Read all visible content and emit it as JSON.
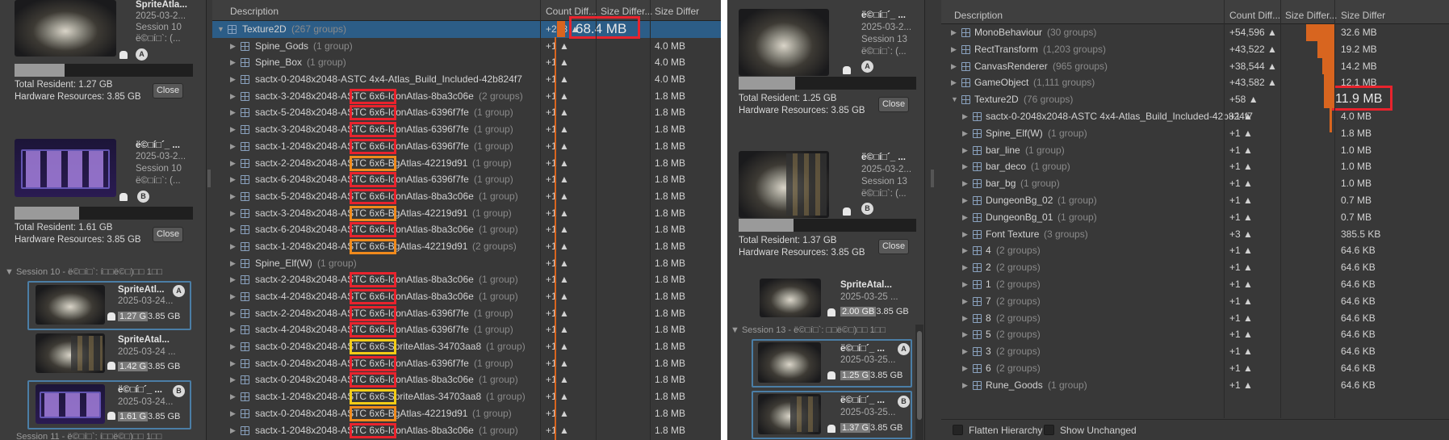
{
  "left": {
    "sessions": [
      {
        "name": "SpriteAtla...",
        "date": "2025-03-2...",
        "session": "Session 10",
        "meta": "ë©□í□`: (...",
        "badge": "A",
        "total": "Total Resident: 1.27 GB",
        "hw": "Hardware Resources: 3.85 GB",
        "close": "Close"
      },
      {
        "name": "ë©□í□´_ ...",
        "date": "2025-03-2...",
        "session": "Session 10",
        "meta": "ë©□í□`: (...",
        "badge": "B",
        "total": "Total Resident: 1.61 GB",
        "hw": "Hardware Resources: 3.85 GB",
        "close": "Close"
      }
    ],
    "group_header": "Session 10 - ë©□í□`: í□□ë©□)□□ 1□□",
    "group_items": [
      {
        "name": "SpriteAtl...",
        "date": "2025-03-24...",
        "a": "1.27 G",
        "b": "3.85 GB",
        "badge": "A"
      },
      {
        "name": "SpriteAtal...",
        "date": "2025-03-24 ...",
        "a": "1.42 G",
        "b": "3.85 GB",
        "badge": ""
      },
      {
        "name": "ë©□í□´_ ...",
        "date": "2025-03-24...",
        "a": "1.61 G",
        "b": "3.85 GB",
        "badge": "B"
      }
    ],
    "next_group": "Session 11 - ë©□í□`: í□□ë©□)□□ 1□□",
    "columns": {
      "desc": "Description",
      "count": "Count Diff...",
      "size": "Size Differ...",
      "size2": "Size Differ"
    },
    "rows": [
      {
        "t": "▼",
        "name": "Texture2D",
        "grp": "(267 groups)",
        "cnt": "+278 ▲",
        "sz": "68.4 MB",
        "sel": true
      },
      {
        "t": "▶",
        "name": "Spine_Gods",
        "grp": "(1 group)",
        "cnt": "+1 ▲",
        "sz": "4.0 MB"
      },
      {
        "t": "▶",
        "name": "Spine_Box",
        "grp": "(1 group)",
        "cnt": "+1 ▲",
        "sz": "4.0 MB"
      },
      {
        "t": "▶",
        "name": "sactx-0-2048x2048-ASTC 4x4-Atlas_Build_Included-42b824f7",
        "grp": "",
        "cnt": "+1 ▲",
        "sz": "4.0 MB"
      },
      {
        "t": "▶",
        "name": "sactx-3-2048x2048-ASTC 6x6-IconAtlas-8ba3c06e",
        "grp": "(2 groups)",
        "cnt": "+1 ▲",
        "sz": "1.8 MB"
      },
      {
        "t": "▶",
        "name": "sactx-5-2048x2048-ASTC 6x6-IconAtlas-6396f7fe",
        "grp": "(1 group)",
        "cnt": "+1 ▲",
        "sz": "1.8 MB"
      },
      {
        "t": "▶",
        "name": "sactx-3-2048x2048-ASTC 6x6-IconAtlas-6396f7fe",
        "grp": "(1 group)",
        "cnt": "+1 ▲",
        "sz": "1.8 MB"
      },
      {
        "t": "▶",
        "name": "sactx-1-2048x2048-ASTC 6x6-IconAtlas-6396f7fe",
        "grp": "(1 group)",
        "cnt": "+1 ▲",
        "sz": "1.8 MB"
      },
      {
        "t": "▶",
        "name": "sactx-2-2048x2048-ASTC 6x6-BgAtlas-42219d91",
        "grp": "(1 group)",
        "cnt": "+1 ▲",
        "sz": "1.8 MB"
      },
      {
        "t": "▶",
        "name": "sactx-6-2048x2048-ASTC 6x6-IconAtlas-6396f7fe",
        "grp": "(1 group)",
        "cnt": "+1 ▲",
        "sz": "1.8 MB"
      },
      {
        "t": "▶",
        "name": "sactx-5-2048x2048-ASTC 6x6-IconAtlas-8ba3c06e",
        "grp": "(1 group)",
        "cnt": "+1 ▲",
        "sz": "1.8 MB"
      },
      {
        "t": "▶",
        "name": "sactx-3-2048x2048-ASTC 6x6-BgAtlas-42219d91",
        "grp": "(1 group)",
        "cnt": "+1 ▲",
        "sz": "1.8 MB"
      },
      {
        "t": "▶",
        "name": "sactx-6-2048x2048-ASTC 6x6-IconAtlas-8ba3c06e",
        "grp": "(1 group)",
        "cnt": "+1 ▲",
        "sz": "1.8 MB"
      },
      {
        "t": "▶",
        "name": "sactx-1-2048x2048-ASTC 6x6-BgAtlas-42219d91",
        "grp": "(2 groups)",
        "cnt": "+1 ▲",
        "sz": "1.8 MB"
      },
      {
        "t": "▶",
        "name": "Spine_Elf(W)",
        "grp": "(1 group)",
        "cnt": "+1 ▲",
        "sz": "1.8 MB"
      },
      {
        "t": "▶",
        "name": "sactx-2-2048x2048-ASTC 6x6-IconAtlas-8ba3c06e",
        "grp": "(1 group)",
        "cnt": "+1 ▲",
        "sz": "1.8 MB"
      },
      {
        "t": "▶",
        "name": "sactx-4-2048x2048-ASTC 6x6-IconAtlas-8ba3c06e",
        "grp": "(1 group)",
        "cnt": "+1 ▲",
        "sz": "1.8 MB"
      },
      {
        "t": "▶",
        "name": "sactx-2-2048x2048-ASTC 6x6-IconAtlas-6396f7fe",
        "grp": "(1 group)",
        "cnt": "+1 ▲",
        "sz": "1.8 MB"
      },
      {
        "t": "▶",
        "name": "sactx-4-2048x2048-ASTC 6x6-IconAtlas-6396f7fe",
        "grp": "(1 group)",
        "cnt": "+1 ▲",
        "sz": "1.8 MB"
      },
      {
        "t": "▶",
        "name": "sactx-0-2048x2048-ASTC 6x6-SpriteAtlas-34703aa8",
        "grp": "(1 group)",
        "cnt": "+1 ▲",
        "sz": "1.8 MB"
      },
      {
        "t": "▶",
        "name": "sactx-0-2048x2048-ASTC 6x6-IconAtlas-6396f7fe",
        "grp": "(1 group)",
        "cnt": "+1 ▲",
        "sz": "1.8 MB"
      },
      {
        "t": "▶",
        "name": "sactx-0-2048x2048-ASTC 6x6-IconAtlas-8ba3c06e",
        "grp": "(1 group)",
        "cnt": "+1 ▲",
        "sz": "1.8 MB"
      },
      {
        "t": "▶",
        "name": "sactx-1-2048x2048-ASTC 6x6-SpriteAtlas-34703aa8",
        "grp": "(1 group)",
        "cnt": "+1 ▲",
        "sz": "1.8 MB"
      },
      {
        "t": "▶",
        "name": "sactx-0-2048x2048-ASTC 6x6-BgAtlas-42219d91",
        "grp": "(1 group)",
        "cnt": "+1 ▲",
        "sz": "1.8 MB"
      },
      {
        "t": "▶",
        "name": "sactx-1-2048x2048-ASTC 6x6-IconAtlas-8ba3c06e",
        "grp": "(1 group)",
        "cnt": "+1 ▲",
        "sz": "1.8 MB"
      }
    ]
  },
  "right": {
    "sessions": [
      {
        "name": "ë©□í□´_ ...",
        "date": "2025-03-2...",
        "session": "Session 13",
        "meta": "ë©□í□`: (...",
        "badge": "A",
        "total": "Total Resident: 1.25 GB",
        "hw": "Hardware Resources: 3.85 GB",
        "close": "Close"
      },
      {
        "name": "ë©□í□´_ ...",
        "date": "2025-03-2...",
        "session": "Session 13",
        "meta": "ë©□í□`: (...",
        "badge": "B",
        "total": "Total Resident: 1.37 GB",
        "hw": "Hardware Resources: 3.85 GB",
        "close": "Close"
      }
    ],
    "prev_item": {
      "name": "SpriteAtal...",
      "date": "2025-03-25 ...",
      "a": "2.00 GB",
      "b": "3.85 GB"
    },
    "group_header": "Session 13 - ë©□í□`: □□ë©□)□□ 1□□",
    "group_items": [
      {
        "name": "ë©□í□´_ ...",
        "date": "2025-03-25...",
        "a": "1.25 G",
        "b": "3.85 GB",
        "badge": "A"
      },
      {
        "name": "ë©□í□´_ ...",
        "date": "2025-03-25...",
        "a": "1.37 G",
        "b": "3.85 GB",
        "badge": "B"
      }
    ],
    "columns": {
      "desc": "Description",
      "count": "Count Diff...",
      "size": "Size Differ...",
      "size2": "Size Differ"
    },
    "rows": [
      {
        "t": "▶",
        "icon": "script",
        "name": "MonoBehaviour",
        "grp": "(30 groups)",
        "cnt": "+54,596 ▲",
        "sz": "32.6 MB"
      },
      {
        "t": "▶",
        "icon": "transform",
        "name": "RectTransform",
        "grp": "(1,203 groups)",
        "cnt": "+43,522 ▲",
        "sz": "19.2 MB"
      },
      {
        "t": "▶",
        "icon": "eye",
        "name": "CanvasRenderer",
        "grp": "(965 groups)",
        "cnt": "+38,544 ▲",
        "sz": "14.2 MB"
      },
      {
        "t": "▶",
        "icon": "cube",
        "name": "GameObject",
        "grp": "(1,111 groups)",
        "cnt": "+43,582 ▲",
        "sz": "12.1 MB"
      },
      {
        "t": "▼",
        "icon": "tex",
        "name": "Texture2D",
        "grp": "(76 groups)",
        "cnt": "+58 ▲",
        "sz": "11.9 MB"
      },
      {
        "t": "▶",
        "icon": "tex",
        "name": "sactx-0-2048x2048-ASTC 4x4-Atlas_Build_Included-42b824f7",
        "grp": "",
        "cnt": "+1 ▲",
        "sz": "4.0 MB"
      },
      {
        "t": "▶",
        "icon": "tex",
        "name": "Spine_Elf(W)",
        "grp": "(1 group)",
        "cnt": "+1 ▲",
        "sz": "1.8 MB"
      },
      {
        "t": "▶",
        "icon": "tex",
        "name": "bar_line",
        "grp": "(1 group)",
        "cnt": "+1 ▲",
        "sz": "1.0 MB"
      },
      {
        "t": "▶",
        "icon": "tex",
        "name": "bar_deco",
        "grp": "(1 group)",
        "cnt": "+1 ▲",
        "sz": "1.0 MB"
      },
      {
        "t": "▶",
        "icon": "tex",
        "name": "bar_bg",
        "grp": "(1 group)",
        "cnt": "+1 ▲",
        "sz": "1.0 MB"
      },
      {
        "t": "▶",
        "icon": "tex",
        "name": "DungeonBg_02",
        "grp": "(1 group)",
        "cnt": "+1 ▲",
        "sz": "0.7 MB"
      },
      {
        "t": "▶",
        "icon": "tex",
        "name": "DungeonBg_01",
        "grp": "(1 group)",
        "cnt": "+1 ▲",
        "sz": "0.7 MB"
      },
      {
        "t": "▶",
        "icon": "tex",
        "name": "Font Texture",
        "grp": "(3 groups)",
        "cnt": "+3 ▲",
        "sz": "385.5 KB"
      },
      {
        "t": "▶",
        "icon": "tex",
        "name": "4",
        "grp": "(2 groups)",
        "cnt": "+1 ▲",
        "sz": "64.6 KB"
      },
      {
        "t": "▶",
        "icon": "tex",
        "name": "2",
        "grp": "(2 groups)",
        "cnt": "+1 ▲",
        "sz": "64.6 KB"
      },
      {
        "t": "▶",
        "icon": "tex",
        "name": "1",
        "grp": "(2 groups)",
        "cnt": "+1 ▲",
        "sz": "64.6 KB"
      },
      {
        "t": "▶",
        "icon": "tex",
        "name": "7",
        "grp": "(2 groups)",
        "cnt": "+1 ▲",
        "sz": "64.6 KB"
      },
      {
        "t": "▶",
        "icon": "tex",
        "name": "8",
        "grp": "(2 groups)",
        "cnt": "+1 ▲",
        "sz": "64.6 KB"
      },
      {
        "t": "▶",
        "icon": "tex",
        "name": "5",
        "grp": "(2 groups)",
        "cnt": "+1 ▲",
        "sz": "64.6 KB"
      },
      {
        "t": "▶",
        "icon": "tex",
        "name": "3",
        "grp": "(2 groups)",
        "cnt": "+1 ▲",
        "sz": "64.6 KB"
      },
      {
        "t": "▶",
        "icon": "tex",
        "name": "6",
        "grp": "(2 groups)",
        "cnt": "+1 ▲",
        "sz": "64.6 KB"
      },
      {
        "t": "▶",
        "icon": "tex",
        "name": "Rune_Goods",
        "grp": "(1 group)",
        "cnt": "+1 ▲",
        "sz": "64.6 KB"
      }
    ],
    "footer": {
      "flatten": "Flatten Hierarchy",
      "unchanged": "Show Unchanged"
    }
  },
  "colors": {
    "selected": "#2c5d87",
    "bar": "#d8651f",
    "red": "#e8232d",
    "orange": "#f08a1c",
    "yellow": "#f2cc16"
  }
}
